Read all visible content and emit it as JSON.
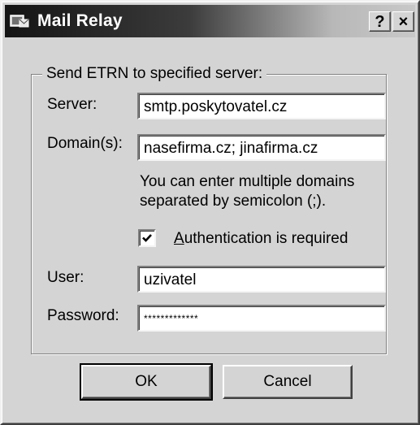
{
  "window": {
    "title": "Mail Relay",
    "help_label": "?",
    "close_label": "×"
  },
  "group": {
    "legend": "Send ETRN to specified server:"
  },
  "server": {
    "label": "Server:",
    "value": "smtp.poskytovatel.cz"
  },
  "domains": {
    "label": "Domain(s):",
    "value": "nasefirma.cz; jinafirma.cz",
    "note": "You can enter multiple domains separated by semicolon (;)."
  },
  "auth": {
    "label_underlined": "A",
    "label_rest": "uthentication is required",
    "checked": true
  },
  "user": {
    "label": "User:",
    "value": "uzivatel"
  },
  "password": {
    "label": "Password:",
    "value": "*************"
  },
  "buttons": {
    "ok": "OK",
    "cancel": "Cancel"
  }
}
